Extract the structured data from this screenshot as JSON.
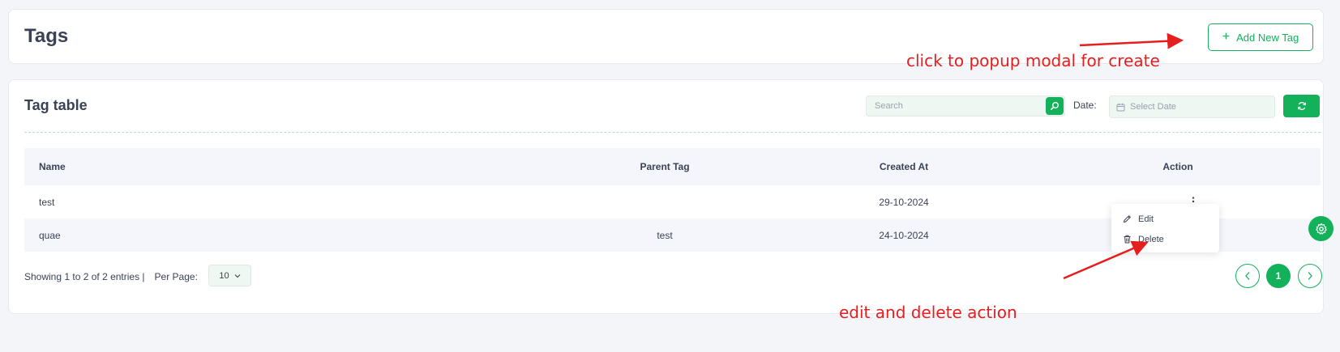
{
  "header": {
    "title": "Tags",
    "add_button_label": "Add New Tag",
    "add_button_icon": "plus-icon"
  },
  "table_card": {
    "title": "Tag table",
    "search": {
      "placeholder": "Search",
      "value": ""
    },
    "date": {
      "label": "Date:",
      "placeholder": "Select Date",
      "value": ""
    },
    "columns": [
      "Name",
      "Parent Tag",
      "Created At",
      "Action"
    ],
    "rows": [
      {
        "name": "test",
        "parent": "",
        "created_at": "29-10-2024"
      },
      {
        "name": "quae",
        "parent": "test",
        "created_at": "24-10-2024"
      }
    ],
    "action_menu": {
      "edit_label": "Edit",
      "delete_label": "Delete"
    },
    "footer": {
      "entries_text": "Showing 1 to 2 of 2 entries |",
      "per_page_label": "Per Page:",
      "per_page_value": "10",
      "current_page": "1"
    }
  },
  "annotations": {
    "top_note": "click to popup modal for create",
    "bottom_note": "edit and delete action"
  },
  "colors": {
    "accent": "#12b15a",
    "annotation": "#e51e1e",
    "text": "#3b4256",
    "page_bg": "#f4f5f9"
  }
}
